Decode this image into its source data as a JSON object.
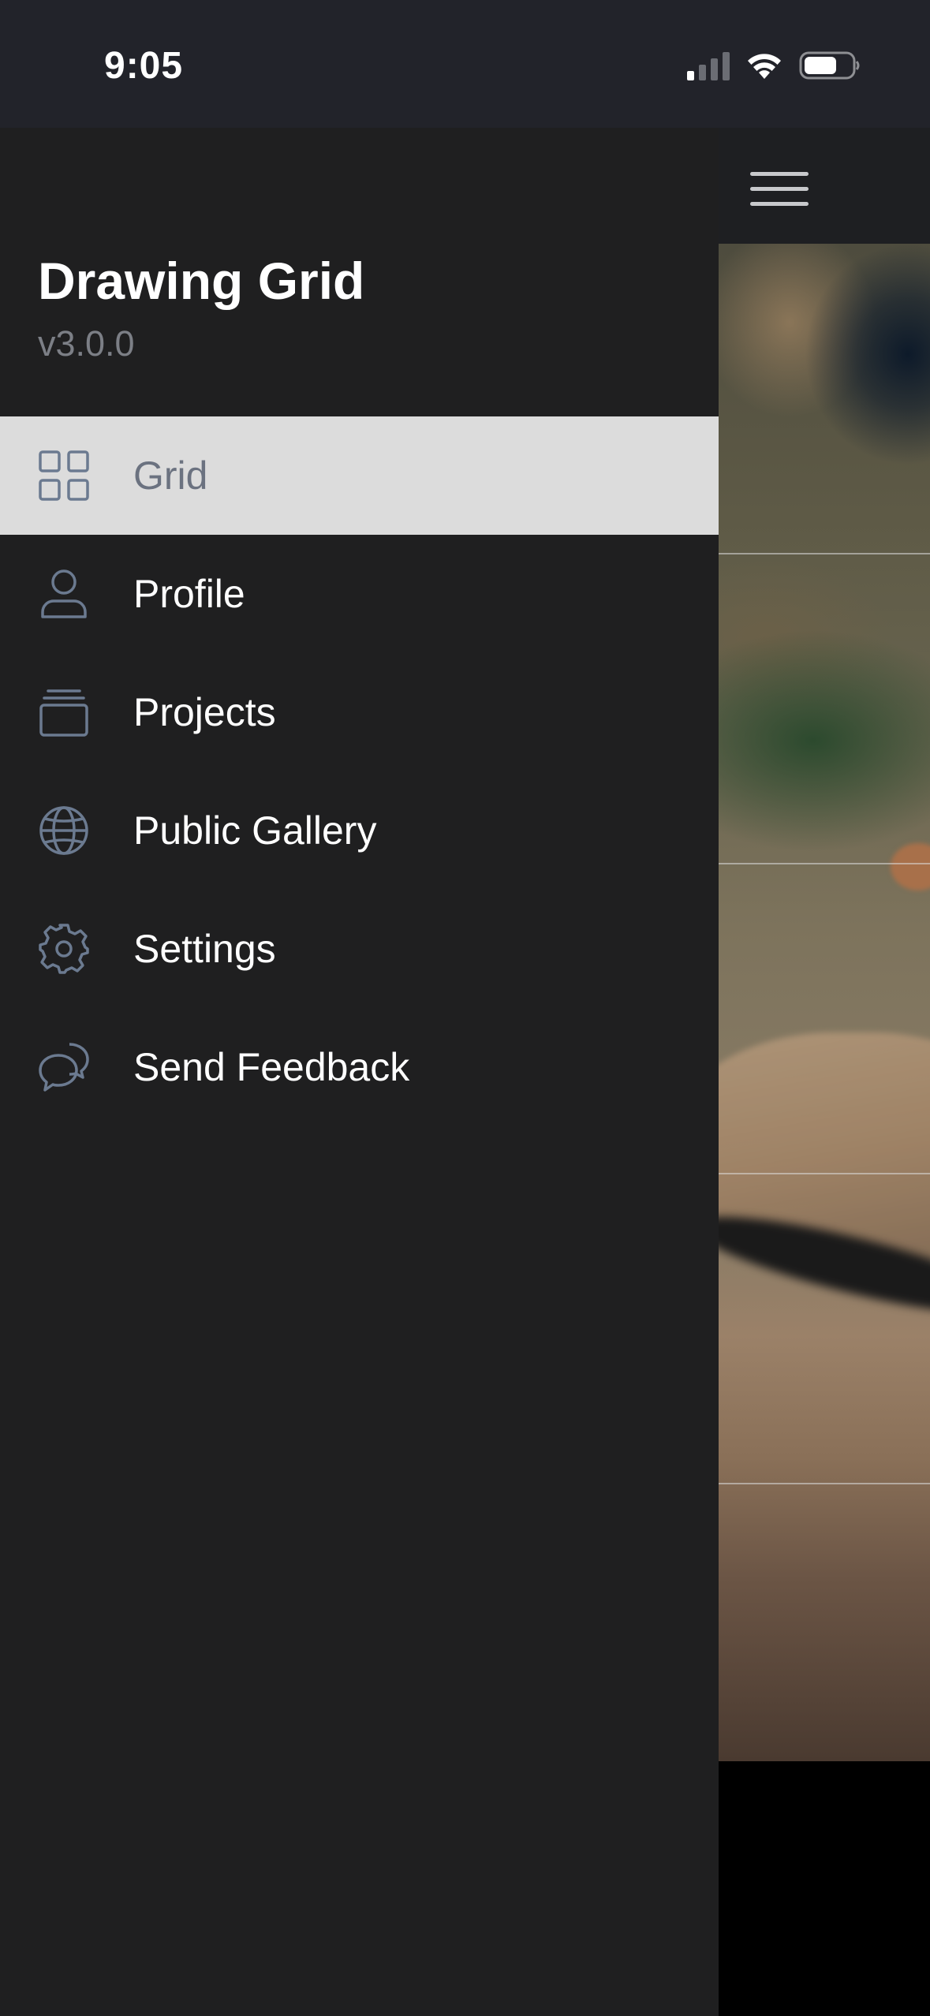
{
  "status_bar": {
    "time": "9:05",
    "icons": [
      "cellular-signal-icon",
      "wifi-icon",
      "battery-icon"
    ]
  },
  "drawer": {
    "title": "Drawing Grid",
    "version": "v3.0.0",
    "menu_items": [
      {
        "label": "Grid",
        "icon": "grid-icon",
        "active": true
      },
      {
        "label": "Profile",
        "icon": "profile-icon",
        "active": false
      },
      {
        "label": "Projects",
        "icon": "projects-icon",
        "active": false
      },
      {
        "label": "Public Gallery",
        "icon": "globe-icon",
        "active": false
      },
      {
        "label": "Settings",
        "icon": "gear-icon",
        "active": false
      },
      {
        "label": "Send Feedback",
        "icon": "chat-bubbles-icon",
        "active": false
      }
    ]
  },
  "main": {
    "menu_button_icon": "hamburger-menu-icon"
  },
  "colors": {
    "drawer_background": "#1f1f20",
    "active_item_background": "#dcdcdc",
    "icon_color": "#6b7a90",
    "status_bar_background": "#22232a"
  }
}
